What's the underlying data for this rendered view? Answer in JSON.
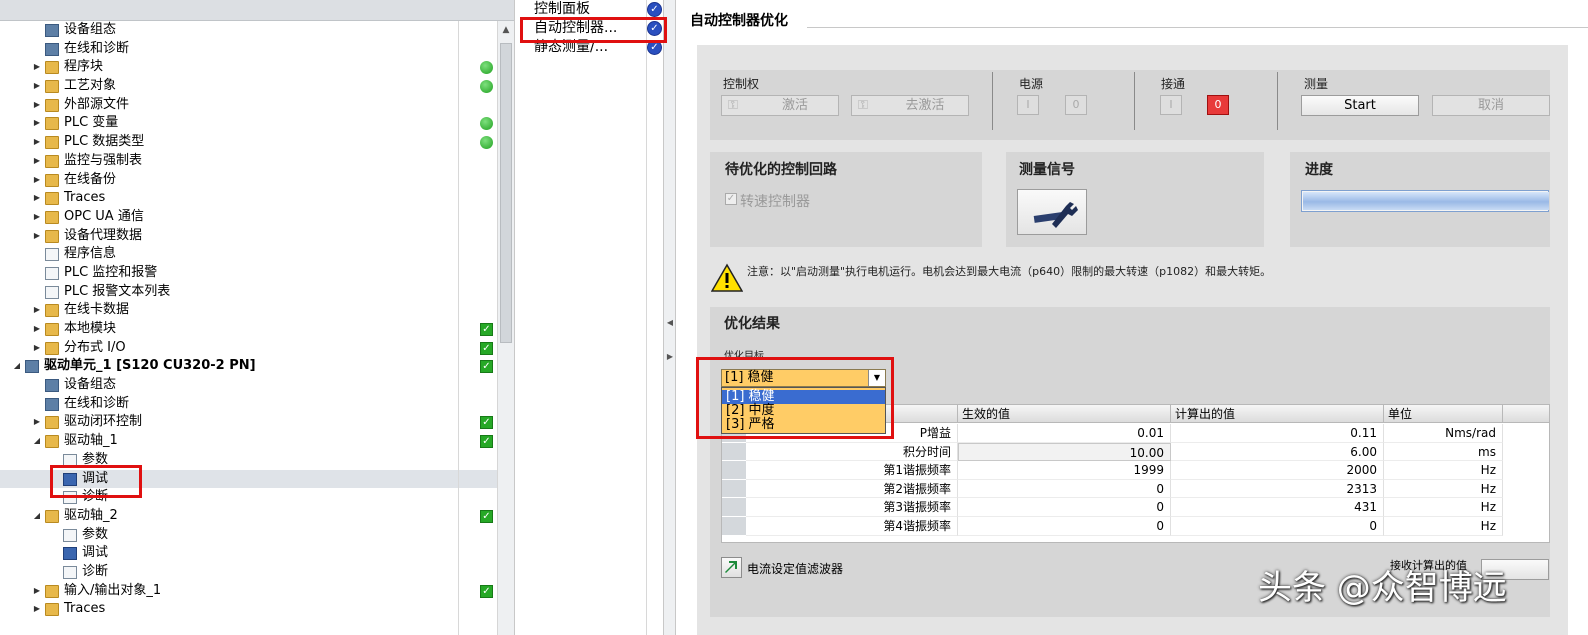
{
  "tree": {
    "rows": [
      {
        "label": "设备组态",
        "indent": 1,
        "icon": "device-config-icon",
        "arrow": "",
        "status": ""
      },
      {
        "label": "在线和诊断",
        "indent": 1,
        "icon": "online-diagnostics-icon",
        "arrow": "",
        "status": ""
      },
      {
        "label": "程序块",
        "indent": 1,
        "icon": "folder-icon",
        "arrow": "right",
        "status": "green"
      },
      {
        "label": "工艺对象",
        "indent": 1,
        "icon": "folder-icon",
        "arrow": "right",
        "status": "green"
      },
      {
        "label": "外部源文件",
        "indent": 1,
        "icon": "folder-icon",
        "arrow": "right",
        "status": ""
      },
      {
        "label": "PLC 变量",
        "indent": 1,
        "icon": "folder-icon",
        "arrow": "right",
        "status": "green"
      },
      {
        "label": "PLC 数据类型",
        "indent": 1,
        "icon": "folder-icon",
        "arrow": "right",
        "status": "green"
      },
      {
        "label": "监控与强制表",
        "indent": 1,
        "icon": "folder-icon",
        "arrow": "right",
        "status": ""
      },
      {
        "label": "在线备份",
        "indent": 1,
        "icon": "folder-icon",
        "arrow": "right",
        "status": ""
      },
      {
        "label": "Traces",
        "indent": 1,
        "icon": "folder-icon",
        "arrow": "right",
        "status": ""
      },
      {
        "label": "OPC UA 通信",
        "indent": 1,
        "icon": "folder-icon",
        "arrow": "right",
        "status": ""
      },
      {
        "label": "设备代理数据",
        "indent": 1,
        "icon": "folder-icon",
        "arrow": "right",
        "status": ""
      },
      {
        "label": "程序信息",
        "indent": 1,
        "icon": "document-icon",
        "arrow": "",
        "status": ""
      },
      {
        "label": "PLC 监控和报警",
        "indent": 1,
        "icon": "alarm-icon",
        "arrow": "",
        "status": ""
      },
      {
        "label": "PLC 报警文本列表",
        "indent": 1,
        "icon": "document-icon",
        "arrow": "",
        "status": ""
      },
      {
        "label": "在线卡数据",
        "indent": 1,
        "icon": "folder-icon",
        "arrow": "right",
        "status": ""
      },
      {
        "label": "本地模块",
        "indent": 1,
        "icon": "folder-icon",
        "arrow": "right",
        "status": "check"
      },
      {
        "label": "分布式 I/O",
        "indent": 1,
        "icon": "folder-icon",
        "arrow": "right",
        "status": "check"
      },
      {
        "label": "驱动单元_1 [S120 CU320-2 PN]",
        "indent": 0,
        "icon": "drive-unit-icon",
        "arrow": "down",
        "status": "check",
        "bold": true
      },
      {
        "label": "设备组态",
        "indent": 1,
        "icon": "device-config-icon",
        "arrow": "",
        "status": ""
      },
      {
        "label": "在线和诊断",
        "indent": 1,
        "icon": "online-diagnostics-icon",
        "arrow": "",
        "status": ""
      },
      {
        "label": "驱动闭环控制",
        "indent": 1,
        "icon": "folder-icon",
        "arrow": "right",
        "status": "check"
      },
      {
        "label": "驱动轴_1",
        "indent": 1,
        "icon": "folder-icon",
        "arrow": "down",
        "status": "check"
      },
      {
        "label": "参数",
        "indent": 2,
        "icon": "parameter-icon",
        "arrow": "",
        "status": ""
      },
      {
        "label": "调试",
        "indent": 2,
        "icon": "commissioning-icon",
        "arrow": "",
        "status": "",
        "selected": true
      },
      {
        "label": "诊断",
        "indent": 2,
        "icon": "diagnostics-icon",
        "arrow": "",
        "status": ""
      },
      {
        "label": "驱动轴_2",
        "indent": 1,
        "icon": "folder-icon",
        "arrow": "down",
        "status": "check"
      },
      {
        "label": "参数",
        "indent": 2,
        "icon": "parameter-icon",
        "arrow": "",
        "status": ""
      },
      {
        "label": "调试",
        "indent": 2,
        "icon": "commissioning-icon",
        "arrow": "",
        "status": ""
      },
      {
        "label": "诊断",
        "indent": 2,
        "icon": "diagnostics-icon",
        "arrow": "",
        "status": ""
      },
      {
        "label": "输入/输出对象_1",
        "indent": 1,
        "icon": "folder-icon",
        "arrow": "right",
        "status": "check"
      },
      {
        "label": "Traces",
        "indent": 1,
        "icon": "folder-icon",
        "arrow": "right",
        "status": ""
      }
    ]
  },
  "nav": {
    "items": [
      "控制面板",
      "自动控制器...",
      "静态测量/..."
    ]
  },
  "editor": {
    "title": "自动控制器优化",
    "control": {
      "label": "控制权",
      "activate": "激活",
      "deactivate": "去激活"
    },
    "power": {
      "label": "电源",
      "on_icon": "I",
      "off_icon": "0"
    },
    "enable": {
      "label": "接通",
      "on_icon": "I",
      "off_icon": "0"
    },
    "measure": {
      "label": "测量",
      "start": "Start",
      "cancel": "取消"
    },
    "loops": {
      "title": "待优化的控制回路",
      "speed_controller": "转速控制器"
    },
    "signal": {
      "title": "测量信号"
    },
    "progress": {
      "title": "进度",
      "value": 1.0
    },
    "notice": "注意：以\"启动测量\"执行电机运行。电机会达到最大电流（p640）限制的最大转速（p1082）和最大转矩。",
    "results": {
      "title": "优化结果",
      "target_label": "优化目标",
      "selected": "[1] 稳健",
      "options": [
        "[1] 稳健",
        "[2] 中度",
        "[3] 严格"
      ],
      "columns": [
        "生效的值",
        "计算出的值",
        "单位"
      ],
      "rows": [
        {
          "name": "P增益",
          "effective": "0.01",
          "calculated": "0.11",
          "unit": "Nms/rad"
        },
        {
          "name": "积分时间",
          "effective": "10.00",
          "calculated": "6.00",
          "unit": "ms"
        },
        {
          "name": "第1谐振频率",
          "effective": "1999",
          "calculated": "2000",
          "unit": "Hz"
        },
        {
          "name": "第2谐振频率",
          "effective": "0",
          "calculated": "2313",
          "unit": "Hz"
        },
        {
          "name": "第3谐振频率",
          "effective": "0",
          "calculated": "431",
          "unit": "Hz"
        },
        {
          "name": "第4谐振频率",
          "effective": "0",
          "calculated": "0",
          "unit": "Hz"
        }
      ],
      "filter": "电流设定值滤波器",
      "accept": "接收计算出的值"
    }
  },
  "watermark": "头条 @众智博远",
  "colors": {
    "highlight_red": "#e01010",
    "dropdown_bg": "#ffcc66",
    "status_green": "#26a826",
    "nav_check_blue": "#2a4fbf"
  }
}
